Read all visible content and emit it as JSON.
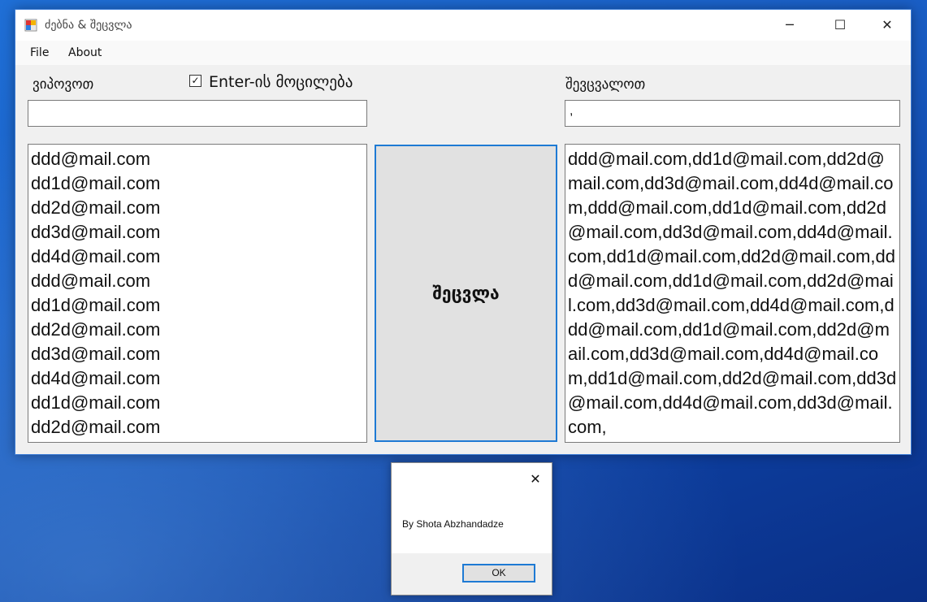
{
  "window": {
    "title": "ძებნა & შეცვლა",
    "controls": {
      "minimize": "─",
      "maximize": "☐",
      "close": "✕"
    }
  },
  "menu": {
    "file": "File",
    "about": "About"
  },
  "search": {
    "label": "ვიპოვოთ",
    "value": ""
  },
  "checkbox": {
    "label": "Enter-ის მოცილება",
    "checked": true,
    "mark": "✓"
  },
  "replace": {
    "label": "შევცვალოთ",
    "value": ","
  },
  "action_button": "შეცვლა",
  "input_list": [
    "ddd@mail.com",
    "dd1d@mail.com",
    "dd2d@mail.com",
    "dd3d@mail.com",
    "dd4d@mail.com",
    "ddd@mail.com",
    "dd1d@mail.com",
    "dd2d@mail.com",
    "dd3d@mail.com",
    "dd4d@mail.com",
    "dd1d@mail.com",
    "dd2d@mail.com"
  ],
  "output_text": "ddd@mail.com,dd1d@mail.com,dd2d@mail.com,dd3d@mail.com,dd4d@mail.com,ddd@mail.com,dd1d@mail.com,dd2d@mail.com,dd3d@mail.com,dd4d@mail.com,dd1d@mail.com,dd2d@mail.com,ddd@mail.com,dd1d@mail.com,dd2d@mail.com,dd3d@mail.com,dd4d@mail.com,ddd@mail.com,dd1d@mail.com,dd2d@mail.com,dd3d@mail.com,dd4d@mail.com,dd1d@mail.com,dd2d@mail.com,dd3d@mail.com,dd4d@mail.com,dd3d@mail.com,",
  "about_dialog": {
    "message": "By Shota Abzhandadze",
    "ok": "OK",
    "close": "✕"
  },
  "colors": {
    "accent": "#1e7ad4",
    "desktop": "#1a5fc6",
    "window_bg": "#f0f0f0"
  }
}
